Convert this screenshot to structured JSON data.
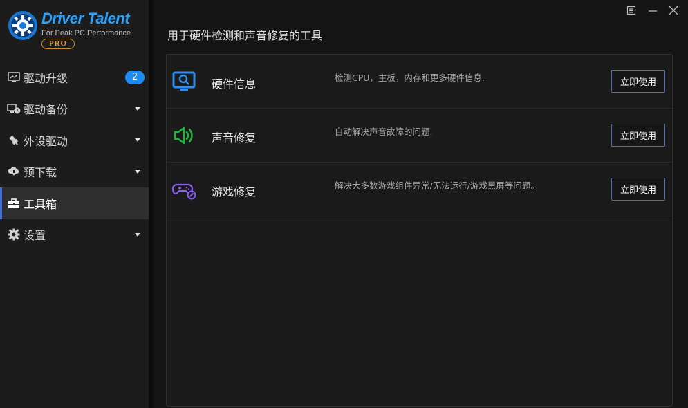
{
  "app": {
    "logo_title": "Driver Talent",
    "logo_subtitle": "For Peak PC Performance",
    "logo_badge": "PRO"
  },
  "sidebar": {
    "items": [
      {
        "label": "驱动升级",
        "icon": "monitor-icon",
        "badge": "2"
      },
      {
        "label": "驱动备份",
        "icon": "backup-icon"
      },
      {
        "label": "外设驱动",
        "icon": "usb-icon"
      },
      {
        "label": "预下载",
        "icon": "cloud-download-icon"
      },
      {
        "label": "工具箱",
        "icon": "toolbox-icon",
        "active": true
      },
      {
        "label": "设置",
        "icon": "gear-icon"
      }
    ]
  },
  "main": {
    "title": "用于硬件检测和声音修复的工具",
    "tools": [
      {
        "name": "硬件信息",
        "desc": "检测CPU，主板，内存和更多硬件信息.",
        "button": "立即使用",
        "icon": "hardware-monitor-icon",
        "color": "#2f8ef0"
      },
      {
        "name": "声音修复",
        "desc": "自动解决声音故障的问题.",
        "button": "立即使用",
        "icon": "speaker-icon",
        "color": "#1fb73a"
      },
      {
        "name": "游戏修复",
        "desc": "解决大多数游戏组件异常/无法运行/游戏黑屏等问题。",
        "button": "立即使用",
        "icon": "gamepad-icon",
        "color": "#8a5cf0"
      }
    ]
  },
  "colors": {
    "accent": "#1e8cf0",
    "button_border": "#4a6fc9",
    "active_bar": "#3f6fd6"
  }
}
